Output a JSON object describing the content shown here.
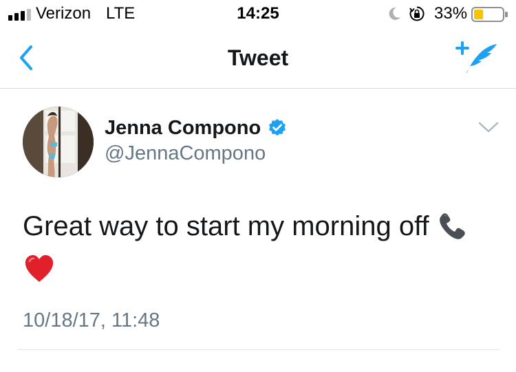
{
  "status_bar": {
    "carrier": "Verizon",
    "network": "LTE",
    "time": "14:25",
    "battery_percent_text": "33%",
    "battery_level": 0.33,
    "signal_bars_filled": 3,
    "signal_bars_total": 4
  },
  "nav": {
    "title": "Tweet",
    "back_icon": "chevron-left-icon",
    "compose_icon": "compose-tweet-icon"
  },
  "tweet": {
    "author_name": "Jenna Compono",
    "author_handle": "@JennaCompono",
    "verified": true,
    "text": "Great way to start my morning off",
    "emojis": [
      "phone-receiver-icon",
      "red-heart-icon"
    ],
    "timestamp": "10/18/17, 11:48"
  },
  "colors": {
    "twitter_blue": "#1da1f2",
    "text_primary": "#14171a",
    "text_secondary": "#657786",
    "battery_fill": "#f5c400"
  }
}
